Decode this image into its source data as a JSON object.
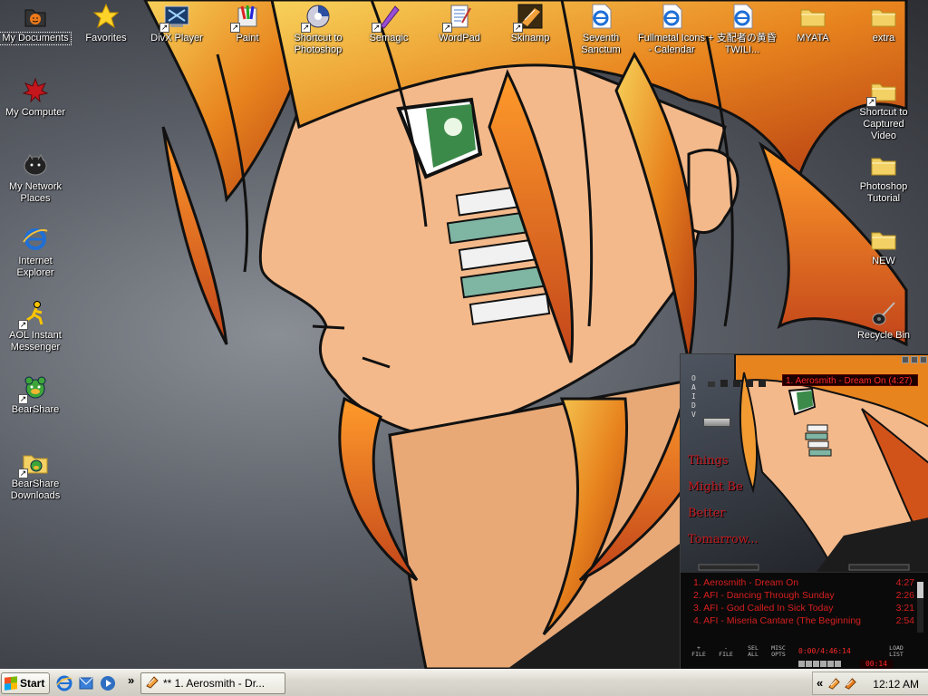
{
  "desktop": {
    "icons": [
      {
        "key": "my_documents",
        "label": "My Documents",
        "icon": "documents-folder-icon",
        "shortcut": false
      },
      {
        "key": "favorites",
        "label": "Favorites",
        "icon": "star-icon",
        "shortcut": false
      },
      {
        "key": "divx",
        "label": "DivX Player",
        "icon": "divx-player-icon",
        "shortcut": true
      },
      {
        "key": "paint",
        "label": "Paint",
        "icon": "paint-icon",
        "shortcut": true
      },
      {
        "key": "photoshop_shortcut",
        "label": "Shortcut to Photoshop",
        "icon": "photoshop-icon",
        "shortcut": true
      },
      {
        "key": "semagic",
        "label": "Semagic",
        "icon": "semagic-quill-icon",
        "shortcut": true
      },
      {
        "key": "wordpad",
        "label": "WordPad",
        "icon": "wordpad-icon",
        "shortcut": true
      },
      {
        "key": "skinamp",
        "label": "Skinamp",
        "icon": "skinamp-icon",
        "shortcut": true
      },
      {
        "key": "seventh_sanctum",
        "label": "Seventh Sanctum",
        "icon": "ie-page-icon",
        "shortcut": false
      },
      {
        "key": "fullmetal_icons",
        "label": "Fullmetal Icons - Calendar",
        "icon": "ie-page-icon",
        "shortcut": false
      },
      {
        "key": "twilight",
        "label": "+ 支配者の黄昏 TWILI...",
        "icon": "ie-page-icon",
        "shortcut": false
      },
      {
        "key": "myata",
        "label": "MYATA",
        "icon": "folder-icon",
        "shortcut": false
      },
      {
        "key": "extra",
        "label": "extra",
        "icon": "folder-icon",
        "shortcut": false
      },
      {
        "key": "my_computer",
        "label": "My Computer",
        "icon": "maple-leaf-icon",
        "shortcut": false
      },
      {
        "key": "captured_video",
        "label": "Shortcut to Captured Video",
        "icon": "folder-icon",
        "shortcut": true
      },
      {
        "key": "my_network",
        "label": "My Network Places",
        "icon": "network-cat-icon",
        "shortcut": false
      },
      {
        "key": "photoshop_tutorial",
        "label": "Photoshop Tutorial",
        "icon": "folder-icon",
        "shortcut": false
      },
      {
        "key": "internet_explorer",
        "label": "Internet Explorer",
        "icon": "internet-explorer-icon",
        "shortcut": false
      },
      {
        "key": "new_folder",
        "label": "NEW",
        "icon": "folder-icon",
        "shortcut": false
      },
      {
        "key": "aim",
        "label": "AOL Instant Messenger",
        "icon": "aim-running-man-icon",
        "shortcut": true
      },
      {
        "key": "recycle_bin",
        "label": "Recycle Bin",
        "icon": "guitar-icon",
        "shortcut": false
      },
      {
        "key": "bearshare",
        "label": "BearShare",
        "icon": "bearshare-icon",
        "shortcut": true
      },
      {
        "key": "bearshare_downloads",
        "label": "BearShare Downloads",
        "icon": "bearshare-folder-icon",
        "shortcut": true
      }
    ]
  },
  "winamp": {
    "now_playing": "1. Aerosmith - Dream On (4:27)",
    "sidebar_letters": [
      "O",
      "A",
      "I",
      "D",
      "V"
    ],
    "lyrics": [
      "Things",
      "Might Be",
      "Better",
      "Tomarrow..."
    ],
    "playlist": [
      {
        "name": "1. Aerosmith - Dream On",
        "time": "4:27"
      },
      {
        "name": "2. AFI - Dancing Through Sunday",
        "time": "2:26"
      },
      {
        "name": "3. AFI - God Called In Sick Today",
        "time": "3:21"
      },
      {
        "name": "4. AFI - Miseria Cantare (The Beginning",
        "time": "2:54"
      }
    ],
    "buttons": [
      {
        "key": "add",
        "label": "+\nFILE"
      },
      {
        "key": "rem",
        "label": "-\nFILE"
      },
      {
        "key": "sel",
        "label": "SEL\nALL"
      },
      {
        "key": "misc",
        "label": "MISC\nOPTS"
      },
      {
        "key": "load",
        "label": "LOAD\nLIST"
      }
    ],
    "time_total": "0:00/4:46:14",
    "time_elapsed": "00:14"
  },
  "taskbar": {
    "start_label": "Start",
    "quick_launch": [
      "internet-explorer-icon",
      "outlook-express-icon",
      "media-player-icon"
    ],
    "overflow": "»",
    "window_label": "** 1. Aerosmith - Dr...",
    "tray_overflow": "«",
    "tray_icons": [
      "skinamp-tray-icon",
      "skinamp-tray-icon-2"
    ],
    "clock": "12:12 AM"
  },
  "colors": {
    "lyric_red": "#c3191f",
    "playlist_red": "#d81e1e",
    "taskbar_bg": "#dcdad0"
  }
}
